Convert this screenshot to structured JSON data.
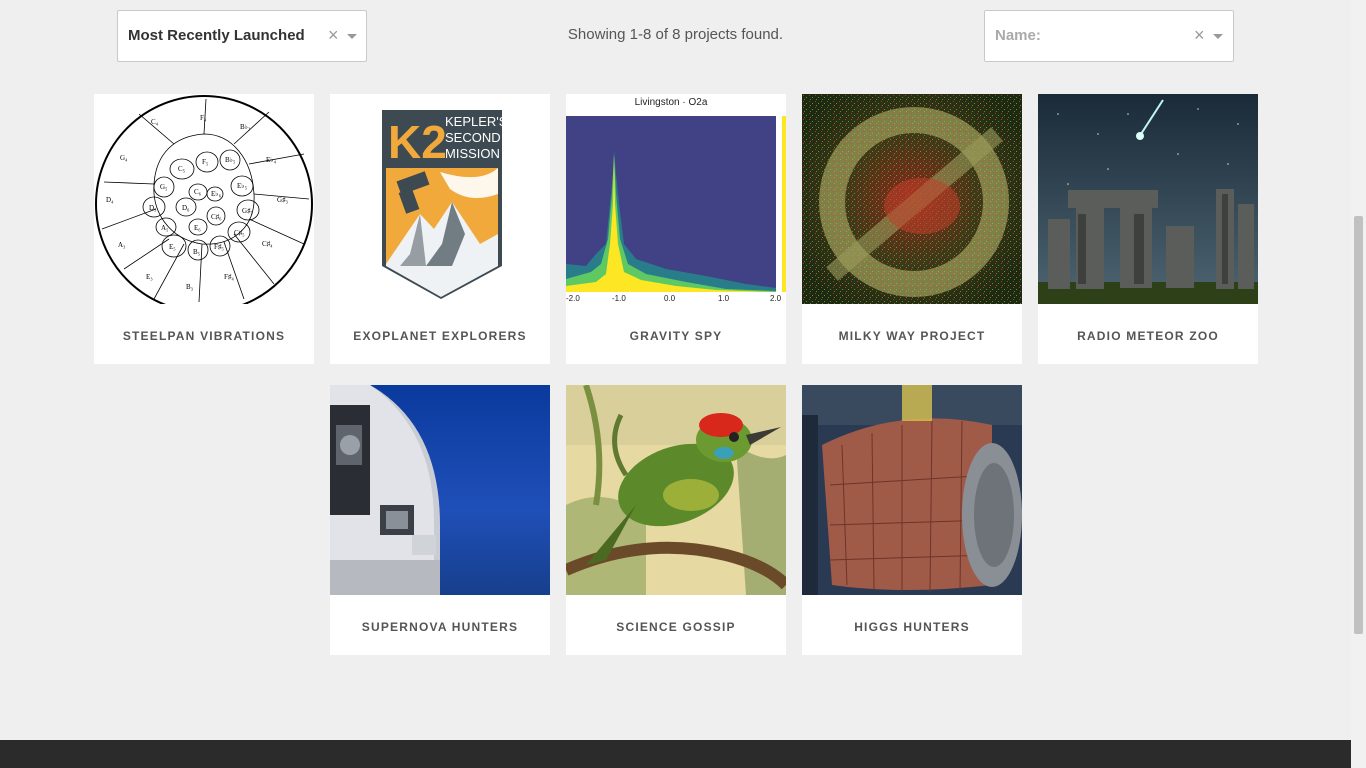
{
  "filters": {
    "sort_value": "Most Recently Launched",
    "name_placeholder": "Name:",
    "clear_glyph": "×",
    "result_count": "Showing 1-8 of 8 projects found."
  },
  "gravity_plot": {
    "title": "Livingston · O2a",
    "ticks": [
      "-2.0",
      "-1.0",
      "0.0",
      "1.0",
      "2.0"
    ]
  },
  "steelpan_notes": [
    "C4",
    "F4",
    "B♭3",
    "E♭4",
    "G4",
    "C5",
    "F5",
    "B♭5",
    "G♯3",
    "D4",
    "G5",
    "C6",
    "E♭5",
    "D5",
    "D6",
    "E6",
    "C♯6",
    "G♯5",
    "A5",
    "E5",
    "B5",
    "F♯5",
    "C♯5",
    "C♯4",
    "A4",
    "E4",
    "B4",
    "F♯4"
  ],
  "k2_badge": {
    "big": "K2",
    "line1": "KEPLER'S",
    "line2": "SECOND",
    "line3": "MISSION"
  },
  "projects": [
    {
      "title": "STEELPAN VIBRATIONS"
    },
    {
      "title": "EXOPLANET EXPLORERS"
    },
    {
      "title": "GRAVITY SPY"
    },
    {
      "title": "MILKY WAY PROJECT"
    },
    {
      "title": "RADIO METEOR ZOO"
    },
    {
      "title": "SUPERNOVA HUNTERS"
    },
    {
      "title": "SCIENCE GOSSIP"
    },
    {
      "title": "HIGGS HUNTERS"
    }
  ]
}
